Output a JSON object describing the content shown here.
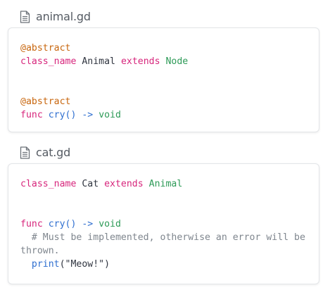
{
  "files": [
    {
      "name": "animal.gd",
      "lines": [
        [
          {
            "t": "@abstract",
            "c": "anno"
          }
        ],
        [
          {
            "t": "class_name",
            "c": "kw"
          },
          {
            "t": " Animal ",
            "c": "plain"
          },
          {
            "t": "extends",
            "c": "kw"
          },
          {
            "t": " ",
            "c": "plain"
          },
          {
            "t": "Node",
            "c": "type"
          }
        ],
        [],
        [],
        [
          {
            "t": "@abstract",
            "c": "anno"
          }
        ],
        [
          {
            "t": "func",
            "c": "kw"
          },
          {
            "t": " ",
            "c": "plain"
          },
          {
            "t": "cry",
            "c": "fn"
          },
          {
            "t": "() -> ",
            "c": "fn"
          },
          {
            "t": "void",
            "c": "type"
          }
        ]
      ]
    },
    {
      "name": "cat.gd",
      "lines": [
        [
          {
            "t": "class_name",
            "c": "kw"
          },
          {
            "t": " Cat ",
            "c": "plain"
          },
          {
            "t": "extends",
            "c": "kw"
          },
          {
            "t": " ",
            "c": "plain"
          },
          {
            "t": "Animal",
            "c": "type"
          }
        ],
        [],
        [],
        [
          {
            "t": "func",
            "c": "kw"
          },
          {
            "t": " ",
            "c": "plain"
          },
          {
            "t": "cry",
            "c": "fn"
          },
          {
            "t": "() -> ",
            "c": "fn"
          },
          {
            "t": "void",
            "c": "type"
          }
        ],
        [
          {
            "t": "  # Must be implemented, otherwise an error will be thrown.",
            "c": "comment"
          }
        ],
        [
          {
            "t": "  ",
            "c": "plain"
          },
          {
            "t": "print",
            "c": "fn"
          },
          {
            "t": "(\"Meow!\")",
            "c": "plain"
          }
        ]
      ]
    }
  ]
}
